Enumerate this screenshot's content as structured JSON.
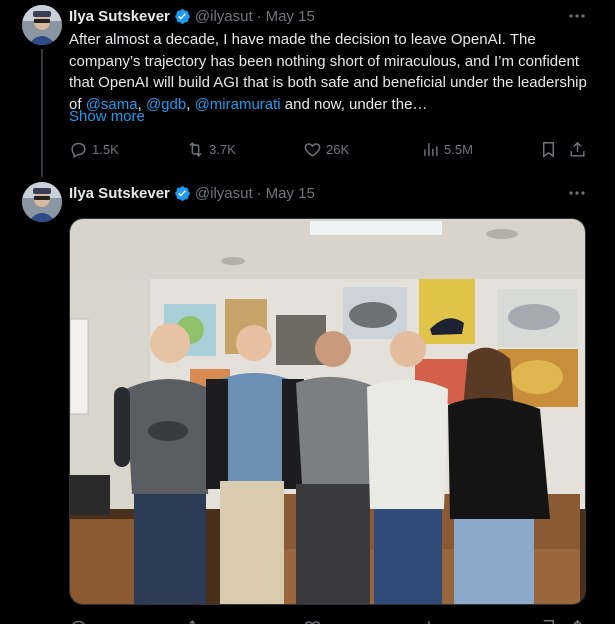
{
  "tweets": [
    {
      "author": {
        "name": "Ilya Sutskever",
        "handle": "@ilyasut"
      },
      "date": "May 15",
      "separator": "·",
      "text": {
        "p1": "After almost a decade, I have made the decision to leave OpenAI.  The company’s trajectory has been nothing short of miraculous, and I’m confident that OpenAI will build AGI that is both safe and beneficial under the leadership of ",
        "m1": "@sama",
        "c1": ", ",
        "m2": "@gdb",
        "c2": ", ",
        "m3": "@miramurati",
        "p2": " and now, under the…"
      },
      "show_more": "Show more",
      "stats": {
        "replies": "1.5K",
        "reposts": "3.7K",
        "likes": "26K",
        "views": "5.5M"
      }
    },
    {
      "author": {
        "name": "Ilya Sutskever",
        "handle": "@ilyasut"
      },
      "date": "May 15",
      "separator": "·",
      "photo": {
        "description_icon": "group-photo"
      }
    }
  ],
  "icons": {
    "verified": "verified-badge-icon",
    "more": "more-dots-icon",
    "reply": "reply-icon",
    "repost": "repost-icon",
    "like": "heart-icon",
    "views": "views-icon",
    "bookmark": "bookmark-icon",
    "share": "share-icon"
  },
  "colors": {
    "background": "#000000",
    "text": "#e7e9ea",
    "muted": "#71767b",
    "link": "#1d9bf0",
    "verified": "#1d9bf0"
  }
}
